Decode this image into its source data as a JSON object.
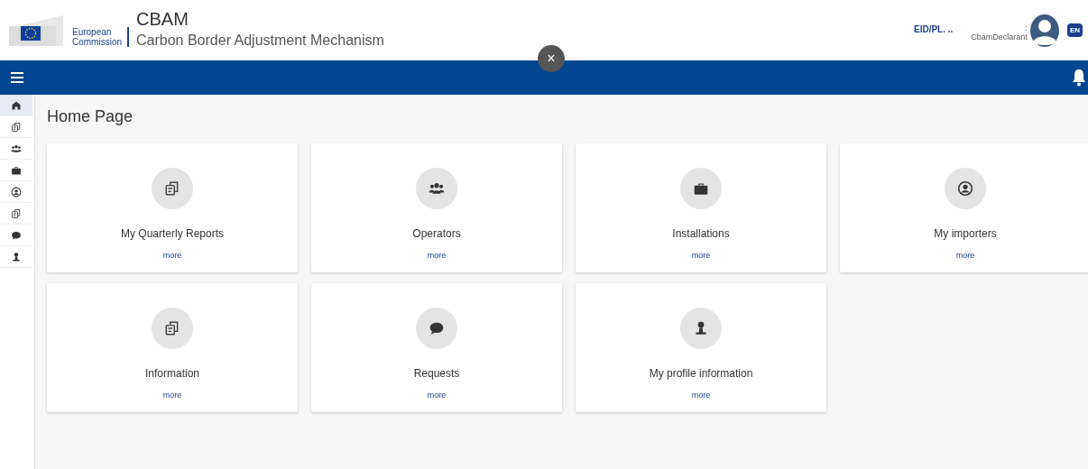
{
  "header": {
    "org_line1": "European",
    "org_line2": "Commission",
    "app_title": "CBAM",
    "app_subtitle": "Carbon Border Adjustment Mechanism",
    "close_label": "×",
    "user_id": "EID/PL. ..",
    "user_sep": ":",
    "user_role": "CbamDeclarant",
    "language": "EN"
  },
  "sidebar": {
    "items": [
      {
        "kind": "home",
        "selected": true
      },
      {
        "kind": "reports",
        "selected": false
      },
      {
        "kind": "operators",
        "selected": false
      },
      {
        "kind": "installations",
        "selected": false
      },
      {
        "kind": "importers",
        "selected": false
      },
      {
        "kind": "information",
        "selected": false
      },
      {
        "kind": "requests",
        "selected": false
      },
      {
        "kind": "profile",
        "selected": false
      }
    ]
  },
  "page_title": "Home Page",
  "cards": [
    {
      "kind": "reports",
      "title": "My Quarterly Reports",
      "link": "more"
    },
    {
      "kind": "operators",
      "title": "Operators",
      "link": "more"
    },
    {
      "kind": "installations",
      "title": "Installations",
      "link": "more"
    },
    {
      "kind": "importers",
      "title": "My importers",
      "link": "more"
    },
    {
      "kind": "information",
      "title": "Information",
      "link": "more"
    },
    {
      "kind": "requests",
      "title": "Requests",
      "link": "more"
    },
    {
      "kind": "profile",
      "title": "My profile information",
      "link": "more"
    }
  ]
}
